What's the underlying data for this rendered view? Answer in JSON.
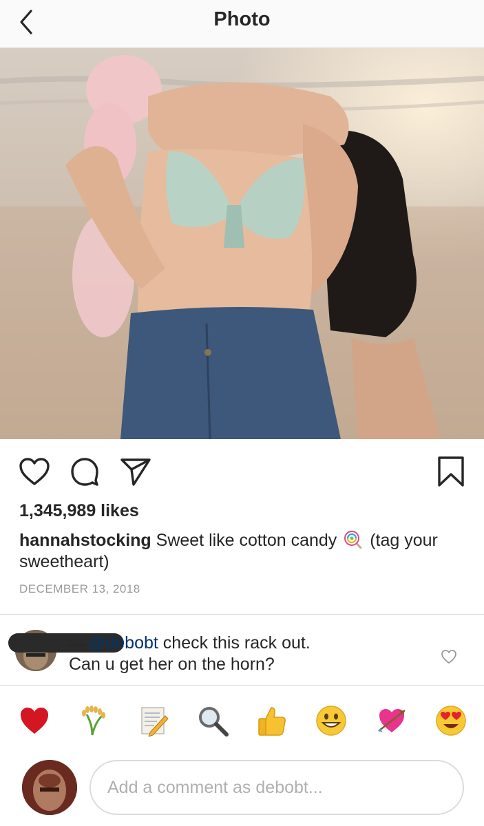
{
  "header": {
    "title": "Photo"
  },
  "post": {
    "likes": "1,345,989 likes",
    "username": "hannahstocking",
    "caption_before_emoji": "Sweet like cotton candy",
    "caption_after_emoji": "(tag your sweetheart)",
    "date": "DECEMBER 13, 2018"
  },
  "comment": {
    "mention": "@debobt",
    "text_line1": "check this rack out.",
    "text_line2": "Can u get her on the horn?"
  },
  "emoji_bar": [
    "red-heart",
    "rice-plant",
    "memo-pencil",
    "magnifying-glass",
    "thumbs-up",
    "grinning-face",
    "heart-with-arrow",
    "heart-eyes-face"
  ],
  "composer": {
    "placeholder": "Add a comment as debobt..."
  },
  "colors": {
    "mention": "#003569",
    "meta": "#999999",
    "border": "#dbdbdb"
  }
}
